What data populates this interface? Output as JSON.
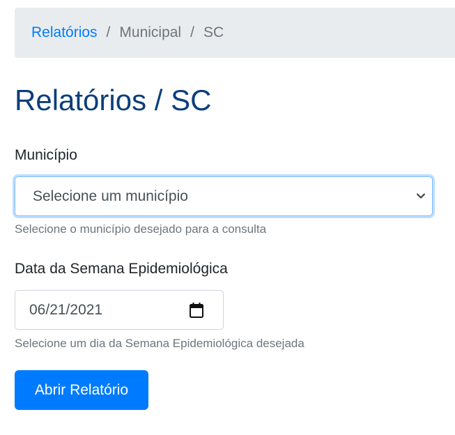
{
  "breadcrumb": {
    "items": [
      {
        "label": "Relatórios",
        "link": true
      },
      {
        "label": "Municipal",
        "link": false
      },
      {
        "label": "SC",
        "link": false
      }
    ],
    "separator": "/"
  },
  "page_title": "Relatórios / SC",
  "municipio": {
    "label": "Município",
    "selected": "Selecione um município",
    "help": "Selecione o município desejado para a consulta"
  },
  "semana": {
    "label": "Data da Semana Epidemiológica",
    "value": "06/21/2021",
    "help": "Selecione um dia da Semana Epidemiológica desejada"
  },
  "submit": {
    "label": "Abrir Relatório"
  },
  "colors": {
    "primary": "#007bff",
    "title": "#0b3e7a",
    "muted": "#6c757d",
    "breadcrumb_bg": "#e9ecef"
  }
}
